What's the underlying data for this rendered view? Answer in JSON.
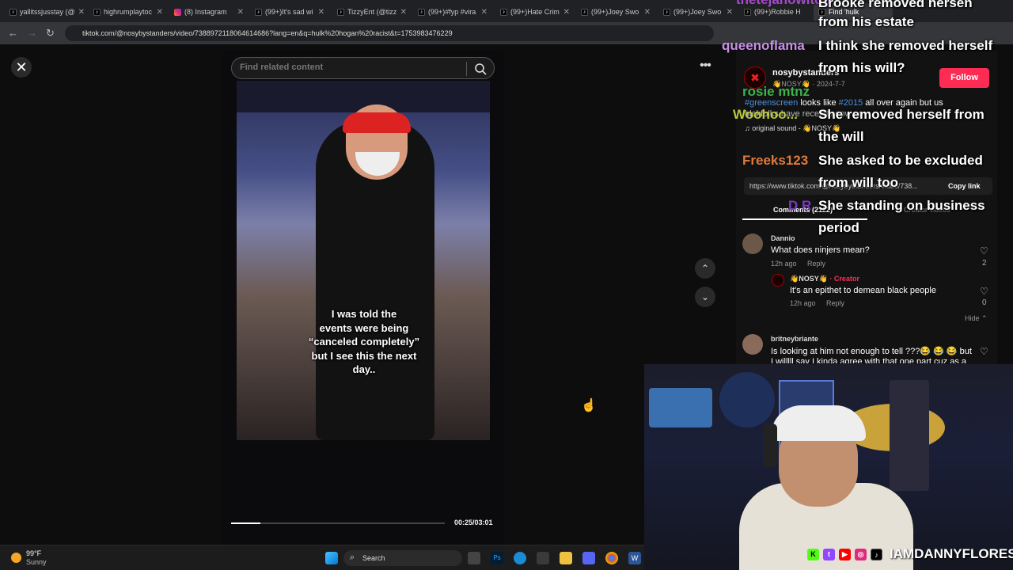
{
  "browser": {
    "tabs": [
      {
        "label": "yallitssjusstay (@",
        "icon": "tiktok-icon"
      },
      {
        "label": "highrumplaytoc",
        "icon": "tiktok-icon"
      },
      {
        "label": "(8) Instagram",
        "icon": "instagram-icon"
      },
      {
        "label": "(99+)It's sad wi",
        "icon": "tiktok-icon"
      },
      {
        "label": "TizzyEnt (@tizz",
        "icon": "tiktok-icon"
      },
      {
        "label": "(99+)#fyp #vira",
        "icon": "tiktok-icon"
      },
      {
        "label": "(99+)Hate Crim",
        "icon": "tiktok-icon"
      },
      {
        "label": "(99+)Joey Swo",
        "icon": "tiktok-icon"
      },
      {
        "label": "(99+)Joey Swo",
        "icon": "tiktok-icon"
      },
      {
        "label": "(99+)Robbie H",
        "icon": "tiktok-icon"
      },
      {
        "label": "Find 'hulk",
        "icon": "tiktok-icon"
      }
    ],
    "url": "tiktok.com/@nosybystanders/video/7388972118064614686?lang=en&q=hulk%20hogan%20racist&t=1753983476229"
  },
  "video": {
    "search_placeholder": "Find related content",
    "caption_lines": [
      "I was told the",
      "events were being",
      "“canceled completely”",
      "but I see this the next",
      "day.."
    ],
    "time": "00:25/03:01",
    "progress": 0.138
  },
  "post": {
    "username": "nosybystanders",
    "display": "👋NOSY👋 · 2024-7-7",
    "follow_label": "Follow",
    "desc_tag1": "#greenscreen",
    "desc_mid": " looks like ",
    "desc_tag2": "#2015",
    "desc_end": " all over again but us",
    "desc_line2": "hlakfolks have receipts now so",
    "sound": "♫  original sound - 👋NOSY👋",
    "link": "https://www.tiktok.com/@nosybystanders/video/738...",
    "copy_link": "Copy link",
    "tab_comments": "Comments (2122)",
    "tab_creator": "Creator videos"
  },
  "comments": [
    {
      "user": "Dannio",
      "text": "What does ninjers mean?",
      "time": "12h ago",
      "reply": "Reply",
      "likes": "2"
    },
    {
      "user": "👋NOSY👋",
      "creator": "· Creator",
      "text": "It's an epithet to demean black people",
      "time": "12h ago",
      "reply": "Reply",
      "likes": "0"
    },
    {
      "user": "britneybriante",
      "text": "Is looking at him not enough to tell ???😂 😂 😂 but",
      "text2": "I willlll say I kinda agree with that one part cuz as a",
      "time": "",
      "reply": "",
      "likes": ""
    }
  ],
  "hide_label": "Hide ⌃",
  "chat": [
    {
      "user": "thetejanowitch",
      "color": "#a64ac9"
    },
    {
      "msg": "Brooke removed hersen"
    },
    {
      "msg": "from his estate"
    },
    {
      "user": "queenoflama",
      "color": "#c890e8"
    },
    {
      "msg": "I think she removed herself"
    },
    {
      "msg": "from his will?"
    },
    {
      "user": "rosie mtnz",
      "color": "#3db34a"
    },
    {
      "user": "Woohoo...",
      "color": "#b8c83a"
    },
    {
      "msg": "She removed herself from"
    },
    {
      "msg": "the will"
    },
    {
      "user": "Freeks123",
      "color": "#e07a3a"
    },
    {
      "msg": "She asked to be excluded"
    },
    {
      "msg": "from will too"
    },
    {
      "user": "D R",
      "color": "#7b3ac2"
    },
    {
      "msg": "She standing on business"
    },
    {
      "msg": "period"
    }
  ],
  "taskbar": {
    "weather_temp": "99°F",
    "weather_desc": "Sunny",
    "search_label": "Search"
  },
  "stream": {
    "handle": "IAMDANNYFLORES"
  }
}
